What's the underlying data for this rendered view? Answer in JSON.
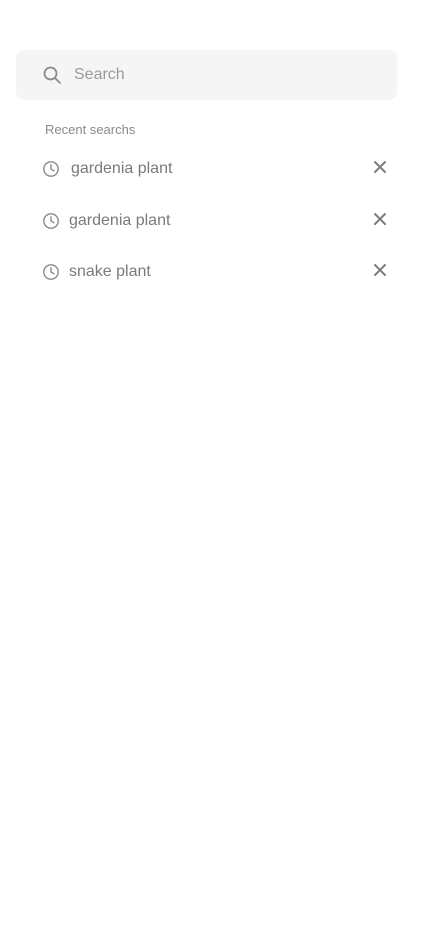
{
  "search": {
    "placeholder": "Search",
    "value": ""
  },
  "recent": {
    "title": "Recent searchs",
    "items": [
      {
        "label": "gardenia plant"
      },
      {
        "label": "gardenia plant"
      },
      {
        "label": "snake plant"
      }
    ]
  },
  "icons": {
    "search": "search-icon",
    "history": "clock-icon",
    "remove": "close-icon"
  },
  "colors": {
    "search_background": "#f5f5f5",
    "text_muted": "#8a8a8a",
    "icon": "#8a8a8a"
  }
}
